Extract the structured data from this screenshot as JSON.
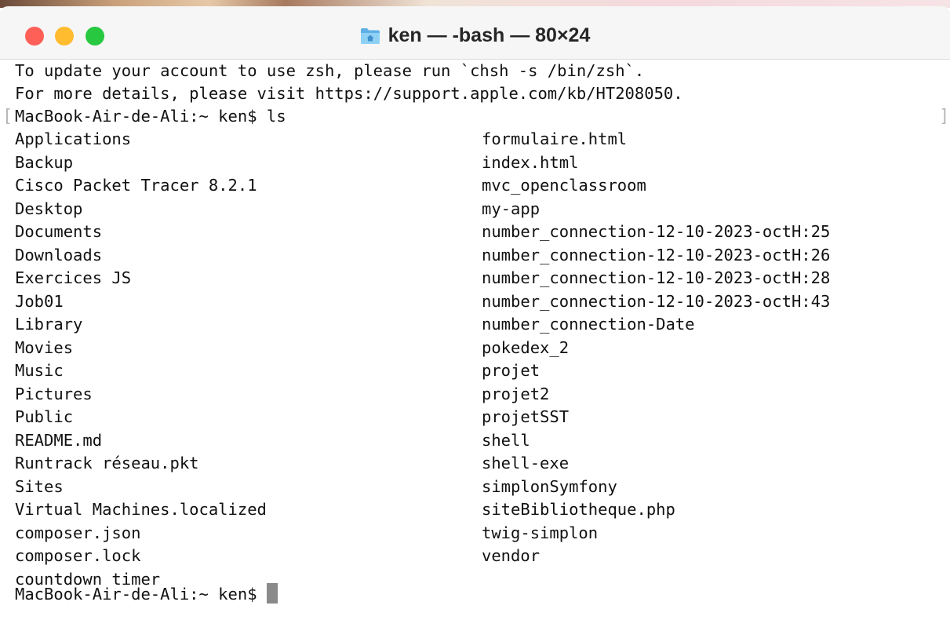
{
  "window": {
    "title": "ken — -bash — 80×24",
    "title_icon": "folder-home-icon",
    "colors": {
      "close": "#fe5f57",
      "minimize": "#febc2e",
      "zoom": "#28c840"
    }
  },
  "terminal": {
    "intro_lines": [
      "To update your account to use zsh, please run `chsh -s /bin/zsh`.",
      "For more details, please visit https://support.apple.com/kb/HT208050."
    ],
    "prompt": "MacBook-Air-de-Ali:~ ken$",
    "command": "ls",
    "ls_left": [
      "Applications",
      "Backup",
      "Cisco Packet Tracer 8.2.1",
      "Desktop",
      "Documents",
      "Downloads",
      "Exercices JS",
      "Job01",
      "Library",
      "Movies",
      "Music",
      "Pictures",
      "Public",
      "README.md",
      "Runtrack réseau.pkt",
      "Sites",
      "Virtual Machines.localized",
      "composer.json",
      "composer.lock",
      "countdown timer"
    ],
    "ls_right": [
      "formulaire.html",
      "index.html",
      "mvc_openclassroom",
      "my-app",
      "number_connection-12-10-2023-octH:25",
      "number_connection-12-10-2023-octH:26",
      "number_connection-12-10-2023-octH:28",
      "number_connection-12-10-2023-octH:43",
      "number_connection-Date",
      "pokedex_2",
      "projet",
      "projet2",
      "projetSST",
      "shell",
      "shell-exe",
      "simplonSymfony",
      "siteBibliotheque.php",
      "twig-simplon",
      "vendor"
    ],
    "final_prompt": "MacBook-Air-de-Ali:~ ken$"
  }
}
